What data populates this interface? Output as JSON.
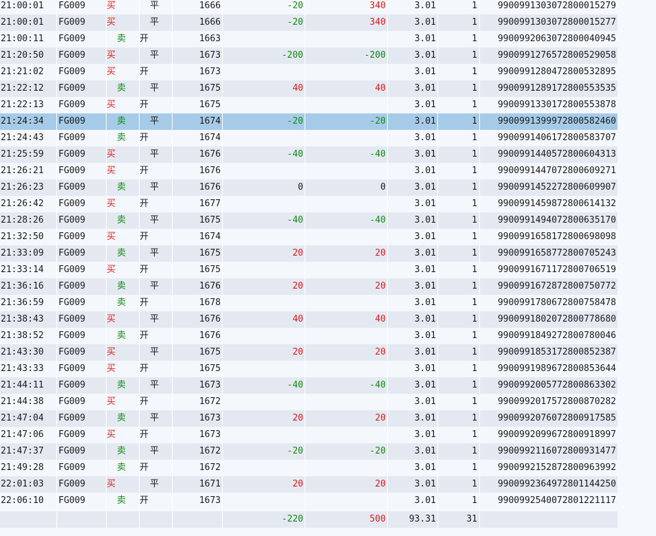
{
  "colors": {
    "buy": "#e0191b",
    "sell": "#138a13",
    "selected_row": "#a6cbe8"
  },
  "selected_index": 7,
  "rows": [
    {
      "time": "21:00:01",
      "code": "FG009",
      "dir": "买",
      "oc": "平",
      "price": "1666",
      "pl1": "-20",
      "pl2": "340",
      "fee": "3.01",
      "qty": "1",
      "id": "9900991303072800015279"
    },
    {
      "time": "21:00:01",
      "code": "FG009",
      "dir": "买",
      "oc": "平",
      "price": "1666",
      "pl1": "-20",
      "pl2": "340",
      "fee": "3.01",
      "qty": "1",
      "id": "9900991303072800015277"
    },
    {
      "time": "21:00:11",
      "code": "FG009",
      "dir": "卖",
      "oc": "开",
      "price": "1663",
      "pl1": "",
      "pl2": "",
      "fee": "3.01",
      "qty": "1",
      "id": "9900992063072800040945"
    },
    {
      "time": "21:20:50",
      "code": "FG009",
      "dir": "买",
      "oc": "平",
      "price": "1673",
      "pl1": "-200",
      "pl2": "-200",
      "fee": "3.01",
      "qty": "1",
      "id": "9900991276572800529058"
    },
    {
      "time": "21:21:02",
      "code": "FG009",
      "dir": "买",
      "oc": "开",
      "price": "1673",
      "pl1": "",
      "pl2": "",
      "fee": "3.01",
      "qty": "1",
      "id": "9900991280472800532895"
    },
    {
      "time": "21:22:12",
      "code": "FG009",
      "dir": "卖",
      "oc": "平",
      "price": "1675",
      "pl1": "40",
      "pl2": "40",
      "fee": "3.01",
      "qty": "1",
      "id": "9900991289172800553535"
    },
    {
      "time": "21:22:13",
      "code": "FG009",
      "dir": "买",
      "oc": "开",
      "price": "1675",
      "pl1": "",
      "pl2": "",
      "fee": "3.01",
      "qty": "1",
      "id": "9900991330172800553878"
    },
    {
      "time": "21:24:34",
      "code": "FG009",
      "dir": "卖",
      "oc": "平",
      "price": "1674",
      "pl1": "-20",
      "pl2": "-20",
      "fee": "3.01",
      "qty": "1",
      "id": "9900991399972800582460"
    },
    {
      "time": "21:24:43",
      "code": "FG009",
      "dir": "卖",
      "oc": "开",
      "price": "1674",
      "pl1": "",
      "pl2": "",
      "fee": "3.01",
      "qty": "1",
      "id": "9900991406172800583707"
    },
    {
      "time": "21:25:59",
      "code": "FG009",
      "dir": "买",
      "oc": "平",
      "price": "1676",
      "pl1": "-40",
      "pl2": "-40",
      "fee": "3.01",
      "qty": "1",
      "id": "9900991440572800604313"
    },
    {
      "time": "21:26:21",
      "code": "FG009",
      "dir": "买",
      "oc": "开",
      "price": "1676",
      "pl1": "",
      "pl2": "",
      "fee": "3.01",
      "qty": "1",
      "id": "9900991447072800609271"
    },
    {
      "time": "21:26:23",
      "code": "FG009",
      "dir": "卖",
      "oc": "平",
      "price": "1676",
      "pl1": "0",
      "pl2": "0",
      "fee": "3.01",
      "qty": "1",
      "id": "9900991452272800609907"
    },
    {
      "time": "21:26:42",
      "code": "FG009",
      "dir": "买",
      "oc": "开",
      "price": "1677",
      "pl1": "",
      "pl2": "",
      "fee": "3.01",
      "qty": "1",
      "id": "9900991459872800614132"
    },
    {
      "time": "21:28:26",
      "code": "FG009",
      "dir": "卖",
      "oc": "平",
      "price": "1675",
      "pl1": "-40",
      "pl2": "-40",
      "fee": "3.01",
      "qty": "1",
      "id": "9900991494072800635170"
    },
    {
      "time": "21:32:50",
      "code": "FG009",
      "dir": "买",
      "oc": "开",
      "price": "1674",
      "pl1": "",
      "pl2": "",
      "fee": "3.01",
      "qty": "1",
      "id": "9900991658172800698098"
    },
    {
      "time": "21:33:09",
      "code": "FG009",
      "dir": "卖",
      "oc": "平",
      "price": "1675",
      "pl1": "20",
      "pl2": "20",
      "fee": "3.01",
      "qty": "1",
      "id": "9900991658772800705243"
    },
    {
      "time": "21:33:14",
      "code": "FG009",
      "dir": "买",
      "oc": "开",
      "price": "1675",
      "pl1": "",
      "pl2": "",
      "fee": "3.01",
      "qty": "1",
      "id": "9900991671172800706519"
    },
    {
      "time": "21:36:16",
      "code": "FG009",
      "dir": "卖",
      "oc": "平",
      "price": "1676",
      "pl1": "20",
      "pl2": "20",
      "fee": "3.01",
      "qty": "1",
      "id": "9900991672872800750772"
    },
    {
      "time": "21:36:59",
      "code": "FG009",
      "dir": "卖",
      "oc": "开",
      "price": "1678",
      "pl1": "",
      "pl2": "",
      "fee": "3.01",
      "qty": "1",
      "id": "9900991780672800758478"
    },
    {
      "time": "21:38:43",
      "code": "FG009",
      "dir": "买",
      "oc": "平",
      "price": "1676",
      "pl1": "40",
      "pl2": "40",
      "fee": "3.01",
      "qty": "1",
      "id": "9900991802072800778680"
    },
    {
      "time": "21:38:52",
      "code": "FG009",
      "dir": "卖",
      "oc": "开",
      "price": "1676",
      "pl1": "",
      "pl2": "",
      "fee": "3.01",
      "qty": "1",
      "id": "9900991849272800780046"
    },
    {
      "time": "21:43:30",
      "code": "FG009",
      "dir": "买",
      "oc": "平",
      "price": "1675",
      "pl1": "20",
      "pl2": "20",
      "fee": "3.01",
      "qty": "1",
      "id": "9900991853172800852387"
    },
    {
      "time": "21:43:33",
      "code": "FG009",
      "dir": "买",
      "oc": "开",
      "price": "1675",
      "pl1": "",
      "pl2": "",
      "fee": "3.01",
      "qty": "1",
      "id": "9900991989672800853644"
    },
    {
      "time": "21:44:11",
      "code": "FG009",
      "dir": "卖",
      "oc": "平",
      "price": "1673",
      "pl1": "-40",
      "pl2": "-40",
      "fee": "3.01",
      "qty": "1",
      "id": "9900992005772800863302"
    },
    {
      "time": "21:44:38",
      "code": "FG009",
      "dir": "买",
      "oc": "开",
      "price": "1672",
      "pl1": "",
      "pl2": "",
      "fee": "3.01",
      "qty": "1",
      "id": "9900992017572800870282"
    },
    {
      "time": "21:47:04",
      "code": "FG009",
      "dir": "卖",
      "oc": "平",
      "price": "1673",
      "pl1": "20",
      "pl2": "20",
      "fee": "3.01",
      "qty": "1",
      "id": "9900992076072800917585"
    },
    {
      "time": "21:47:06",
      "code": "FG009",
      "dir": "买",
      "oc": "开",
      "price": "1673",
      "pl1": "",
      "pl2": "",
      "fee": "3.01",
      "qty": "1",
      "id": "9900992099672800918997"
    },
    {
      "time": "21:47:37",
      "code": "FG009",
      "dir": "卖",
      "oc": "平",
      "price": "1672",
      "pl1": "-20",
      "pl2": "-20",
      "fee": "3.01",
      "qty": "1",
      "id": "9900992116072800931477"
    },
    {
      "time": "21:49:28",
      "code": "FG009",
      "dir": "卖",
      "oc": "开",
      "price": "1672",
      "pl1": "",
      "pl2": "",
      "fee": "3.01",
      "qty": "1",
      "id": "9900992152872800963992"
    },
    {
      "time": "22:01:03",
      "code": "FG009",
      "dir": "买",
      "oc": "平",
      "price": "1671",
      "pl1": "20",
      "pl2": "20",
      "fee": "3.01",
      "qty": "1",
      "id": "9900992364972801144250"
    },
    {
      "time": "22:06:10",
      "code": "FG009",
      "dir": "卖",
      "oc": "开",
      "price": "1673",
      "pl1": "",
      "pl2": "",
      "fee": "3.01",
      "qty": "1",
      "id": "9900992540072801221117"
    }
  ],
  "totals": {
    "pl1": "-220",
    "pl2": "500",
    "fee": "93.31",
    "qty": "31"
  }
}
